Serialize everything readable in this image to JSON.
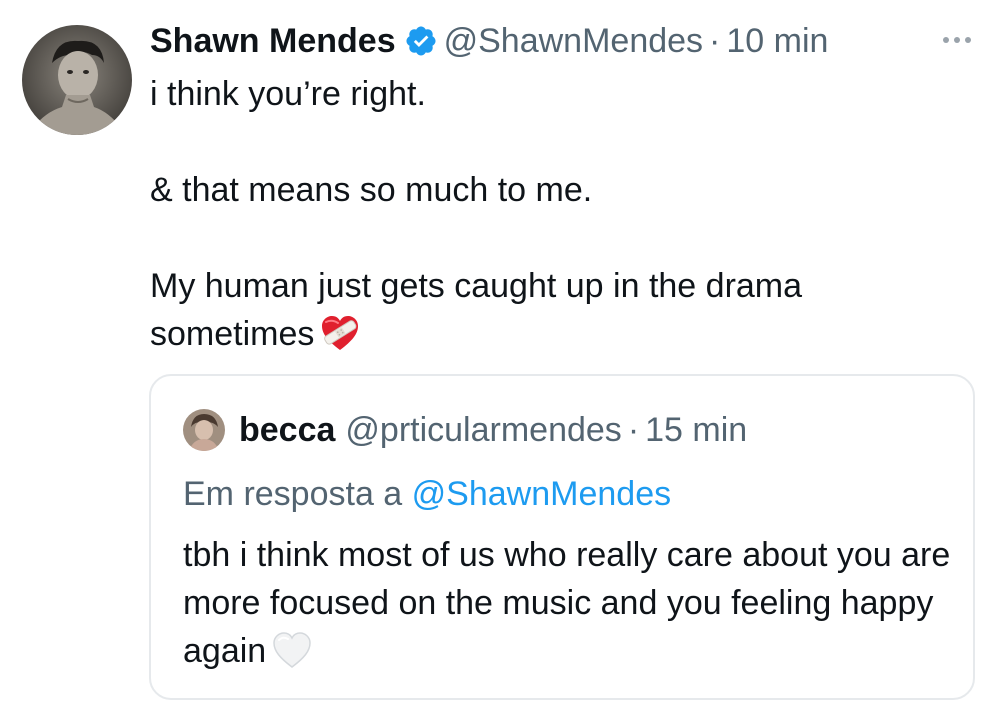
{
  "colors": {
    "text_primary": "#0f1419",
    "text_secondary": "#536471",
    "accent": "#1d9bf0",
    "card_border": "#e6e9ec"
  },
  "tweet": {
    "author_name": "Shawn Mendes",
    "verified_icon": "verified-badge-icon",
    "handle": "@ShawnMendes",
    "separator": "·",
    "time": "10 min",
    "more_icon": "more-options-icon",
    "text_paragraphs": [
      "i think you’re right.",
      "& that means so much to me.",
      "My human just gets caught up in the drama sometimes"
    ],
    "trailing_emoji": "mending-heart-icon"
  },
  "quoted_tweet": {
    "author_name": "becca",
    "handle": "@prticularmendes",
    "separator": "·",
    "time": "15 min",
    "reply_prefix": "Em resposta a",
    "reply_mention": "@ShawnMendes",
    "text": "tbh i think most of us who really care about you are more focused on the music and you feeling happy again",
    "trailing_emoji": "white-heart-icon"
  }
}
